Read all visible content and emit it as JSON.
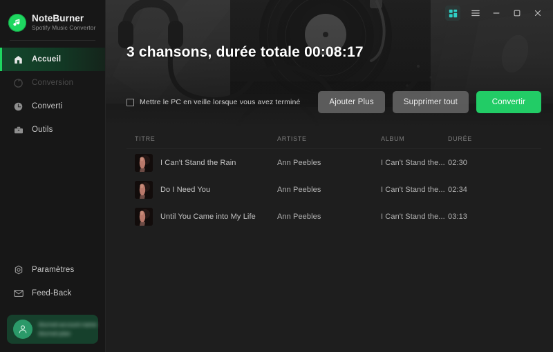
{
  "brand": {
    "name": "NoteBurner",
    "subtitle": "Spotify Music Convertor",
    "logo_icon": "music-note-icon",
    "accent_color": "#1ed760"
  },
  "sidebar": {
    "items": [
      {
        "id": "accueil",
        "label": "Accueil",
        "icon": "home-icon",
        "active": true,
        "disabled": false
      },
      {
        "id": "conversion",
        "label": "Conversion",
        "icon": "refresh-icon",
        "active": false,
        "disabled": true
      },
      {
        "id": "converti",
        "label": "Converti",
        "icon": "clock-icon",
        "active": false,
        "disabled": false
      },
      {
        "id": "outils",
        "label": "Outils",
        "icon": "toolbox-icon",
        "active": false,
        "disabled": false
      }
    ],
    "bottom_items": [
      {
        "id": "parametres",
        "label": "Paramètres",
        "icon": "gear-icon"
      },
      {
        "id": "feedback",
        "label": "Feed-Back",
        "icon": "envelope-icon"
      }
    ],
    "user_card": {
      "avatar_icon": "user-icon",
      "line1": "blurred-account-name",
      "line2": "blurred-plan",
      "background_color": "#16402c"
    }
  },
  "titlebar": {
    "buttons": [
      {
        "id": "grid",
        "label": "",
        "icon": "grid-four-squares-icon",
        "color": "#2fd0c6"
      },
      {
        "id": "menu",
        "label": "",
        "icon": "hamburger-menu-icon"
      },
      {
        "id": "minimize",
        "label": "",
        "icon": "minimize-icon"
      },
      {
        "id": "maximize",
        "label": "",
        "icon": "maximize-icon"
      },
      {
        "id": "close",
        "label": "",
        "icon": "close-icon"
      }
    ]
  },
  "hero": {
    "title": "3 chansons, durée totale 00:08:17",
    "sleep_checkbox": {
      "label": "Mettre le PC en veille lorsque vous avez terminé",
      "checked": false
    },
    "buttons": {
      "add_more": "Ajouter Plus",
      "delete_all": "Supprimer tout",
      "convert": "Convertir",
      "convert_color": "#22cc66"
    }
  },
  "table": {
    "headers": {
      "title": "TITRE",
      "artist": "ARTISTE",
      "album": "ALBUM",
      "duration": "DURÉE"
    },
    "rows": [
      {
        "title": "I Can't Stand the Rain",
        "artist": "Ann Peebles",
        "album": "I Can't Stand the...",
        "duration": "02:30",
        "thumb_icon": "album-art-icon"
      },
      {
        "title": "Do I Need You",
        "artist": "Ann Peebles",
        "album": "I Can't Stand the...",
        "duration": "02:34",
        "thumb_icon": "album-art-icon"
      },
      {
        "title": "Until You Came into My Life",
        "artist": "Ann Peebles",
        "album": "I Can't Stand the...",
        "duration": "03:13",
        "thumb_icon": "album-art-icon"
      }
    ]
  }
}
